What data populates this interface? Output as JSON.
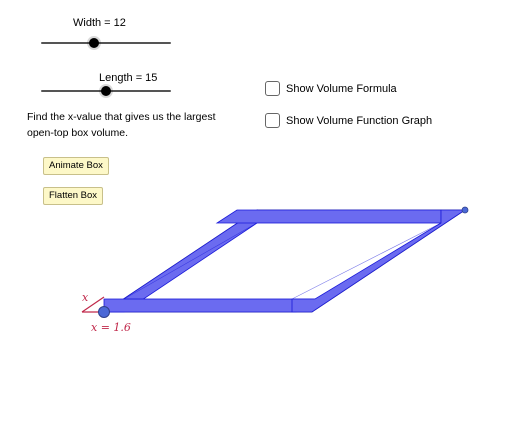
{
  "sliders": {
    "width": {
      "label": "Width = 12",
      "value": 12,
      "level": 0.5
    },
    "length": {
      "label": "Length = 15",
      "value": 15,
      "level": 0.5
    }
  },
  "instructions": "Find the x-value that gives us the largest open-top box volume.",
  "buttons": {
    "animate": "Animate Box",
    "flatten": "Flatten Box"
  },
  "checkboxes": {
    "volume_formula": {
      "label": "Show Volume Formula",
      "checked": false
    },
    "volume_graph": {
      "label": "Show Volume Function Graph",
      "checked": false
    }
  },
  "graphic": {
    "x_label": "x",
    "x_value_label": "x = 1.6",
    "colors": {
      "flap_fill": "#6b6bf0",
      "flap_stroke": "#1a1ad9",
      "outline": "#333333",
      "accent_red": "#c0284a",
      "point": "#4b68d6"
    }
  }
}
